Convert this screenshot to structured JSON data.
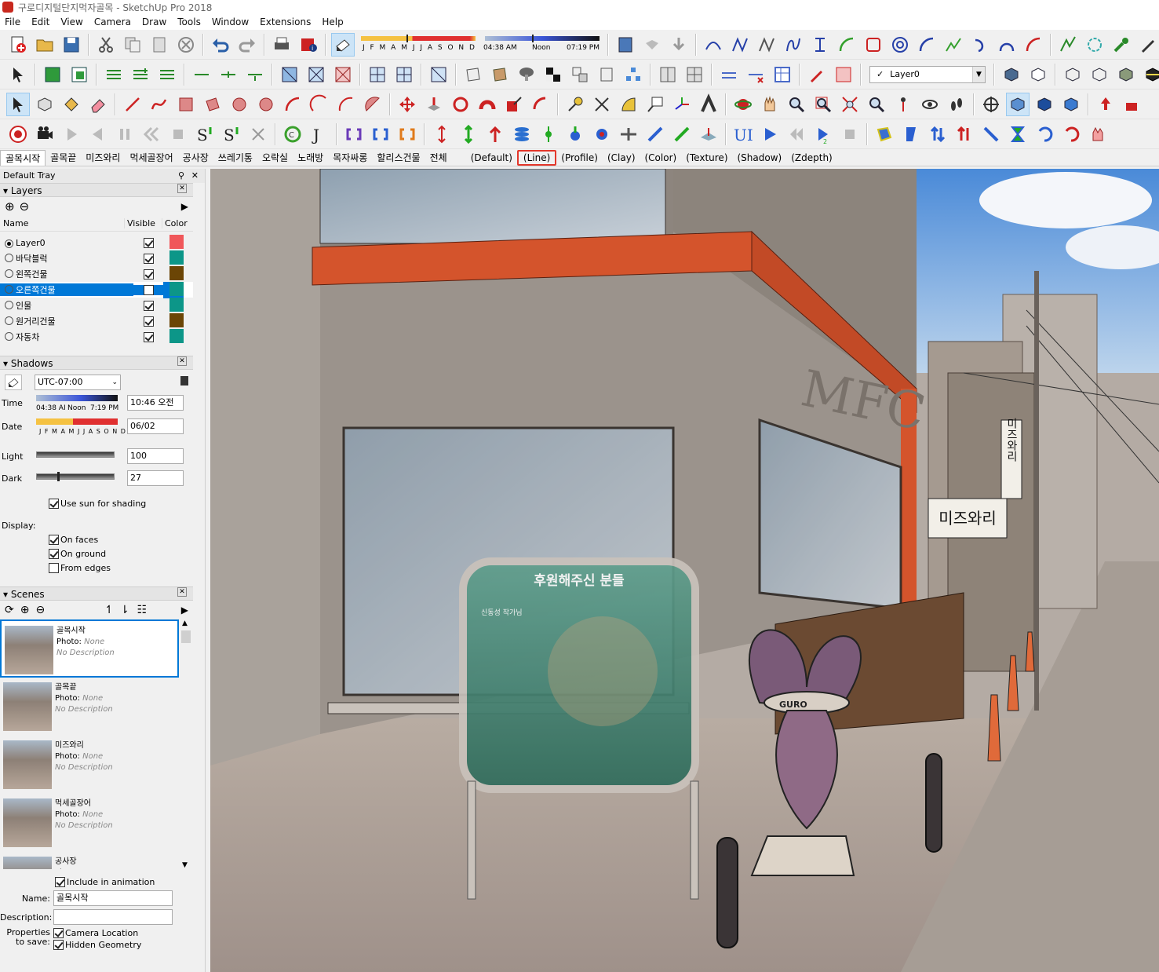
{
  "window": {
    "title": "구로디지털단지먹자골목 - SketchUp Pro 2018"
  },
  "menu": [
    "File",
    "Edit",
    "View",
    "Camera",
    "Draw",
    "Tools",
    "Window",
    "Extensions",
    "Help"
  ],
  "shadow_toolbar": {
    "months": "J F M A M J J A S O N D",
    "time_start": "04:38 AM",
    "time_mid": "Noon",
    "time_end": "07:19 PM"
  },
  "layer_dropdown": {
    "value": "Layer0",
    "check": "✓"
  },
  "scene_tabs": [
    "골목시작",
    "골목끝",
    "미즈와리",
    "먹세골장어",
    "공사장",
    "쓰레기통",
    "오락실",
    "노래방",
    "목자싸롱",
    "할리스건물",
    "전체",
    "(Default)",
    "(Line)",
    "(Profile)",
    "(Clay)",
    "(Color)",
    "(Texture)",
    "(Shadow)",
    "(Zdepth)"
  ],
  "tray": {
    "title": "Default Tray"
  },
  "layers": {
    "title": "Layers",
    "col_name": "Name",
    "col_visible": "Visible",
    "col_color": "Color",
    "rows": [
      {
        "name": "Layer0",
        "visible": true,
        "color": "#f0575a",
        "active": true
      },
      {
        "name": "바닥블럭",
        "visible": true,
        "color": "#0c9688",
        "active": false
      },
      {
        "name": "왼쪽건물",
        "visible": true,
        "color": "#6b4505",
        "active": false
      },
      {
        "name": "오른쪽건물",
        "visible": false,
        "color": "#0c9688",
        "active": false,
        "selected": true
      },
      {
        "name": "인물",
        "visible": true,
        "color": "#0c9688",
        "active": false
      },
      {
        "name": "원거리건물",
        "visible": true,
        "color": "#6b4505",
        "active": false
      },
      {
        "name": "자동차",
        "visible": true,
        "color": "#0c9688",
        "active": false
      }
    ]
  },
  "shadows": {
    "title": "Shadows",
    "timezone": "UTC-07:00",
    "time_label": "Time",
    "time_start": "04:38 AI",
    "time_mid": "Noon",
    "time_end": "7:19 PM",
    "time_value": "10:46 오전",
    "date_label": "Date",
    "date_months": "J F M A M J J A S O N D",
    "date_value": "06/02",
    "light_label": "Light",
    "light_value": "100",
    "light_level": 1.0,
    "dark_label": "Dark",
    "dark_value": "27",
    "dark_level": 0.27,
    "use_sun": "Use sun for shading",
    "display_label": "Display:",
    "on_faces": "On faces",
    "on_ground": "On ground",
    "from_edges": "From edges"
  },
  "scenes": {
    "title": "Scenes",
    "items": [
      {
        "name": "골목시작",
        "photo_label": "Photo:",
        "photo": "None",
        "desc": "No Description"
      },
      {
        "name": "골목끝",
        "photo_label": "Photo:",
        "photo": "None",
        "desc": "No Description"
      },
      {
        "name": "미즈와리",
        "photo_label": "Photo:",
        "photo": "None",
        "desc": "No Description"
      },
      {
        "name": "먹세골장어",
        "photo_label": "Photo:",
        "photo": "None",
        "desc": "No Description"
      },
      {
        "name": "공사장",
        "photo_label": "Photo:",
        "photo": "None",
        "desc": ""
      }
    ],
    "include_animation": "Include in animation",
    "name_label": "Name:",
    "name_value": "골목시작",
    "desc_label": "Description:",
    "props_label": "Properties to save:",
    "camera_location": "Camera Location",
    "hidden_geometry": "Hidden Geometry"
  },
  "scene_art": {
    "board_title": "후원해주신 분들",
    "board_sub": "신동성 작가님",
    "sign_mfc": "MFC",
    "sign_v": "미즈와리",
    "sign_h": "미즈와리",
    "sculpture": "GURO"
  },
  "colors": {
    "accent": "#0078d7",
    "highlight": "#e3372b",
    "orange_band": "#d4542c"
  }
}
